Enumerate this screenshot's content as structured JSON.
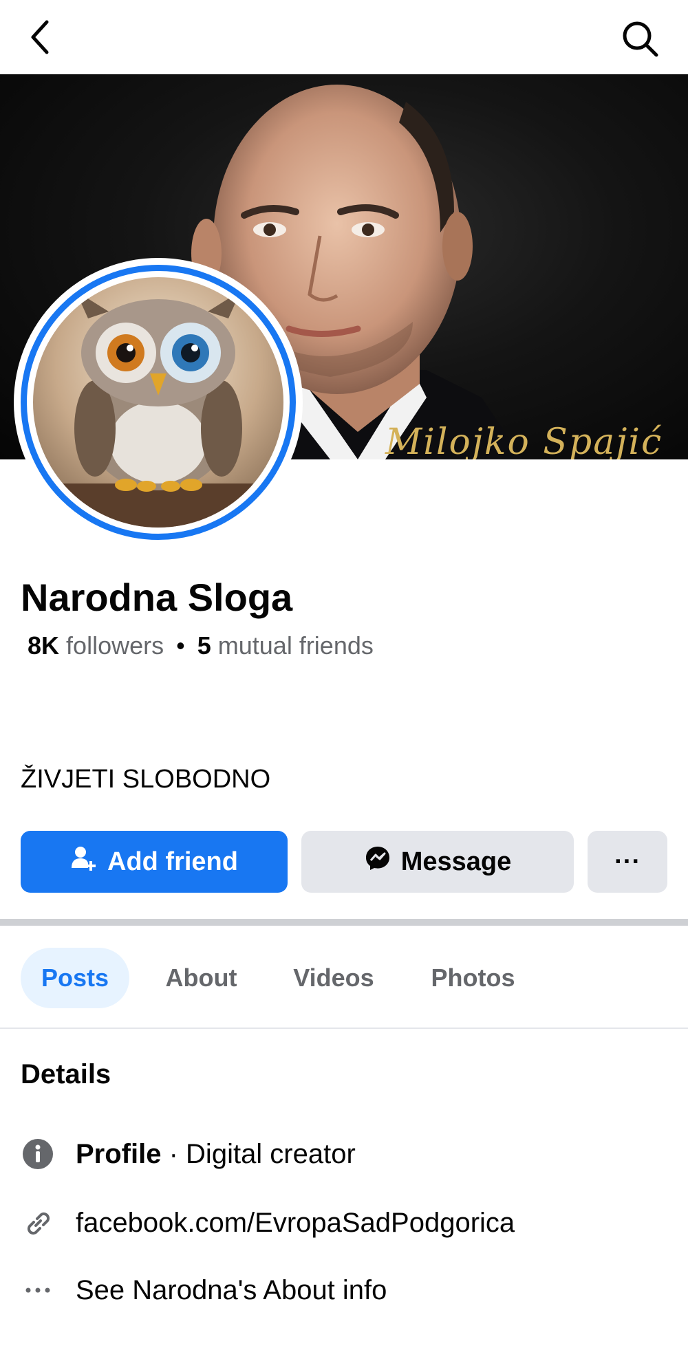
{
  "header": {
    "back_icon": "chevron-left-icon",
    "search_icon": "search-icon"
  },
  "cover": {
    "signature": "Milojko Spajić"
  },
  "profile": {
    "name": "Narodna Sloga",
    "followers_count": "8K",
    "followers_label": "followers",
    "mutual_count": "5",
    "mutual_label": "mutual friends",
    "bio": "ŽIVJETI SLOBODNO"
  },
  "actions": {
    "add_friend": "Add friend",
    "message": "Message",
    "more": "···"
  },
  "tabs": [
    {
      "label": "Posts",
      "active": true
    },
    {
      "label": "About",
      "active": false
    },
    {
      "label": "Videos",
      "active": false
    },
    {
      "label": "Photos",
      "active": false
    }
  ],
  "details": {
    "title": "Details",
    "profile_label": "Profile",
    "profile_type": "· Digital creator",
    "link": "facebook.com/EvropaSadPodgorica",
    "about_link": "See Narodna's About info"
  },
  "colors": {
    "accent": "#1877f2",
    "button_gray": "#e4e6eb",
    "secondary_text": "#65676b"
  }
}
